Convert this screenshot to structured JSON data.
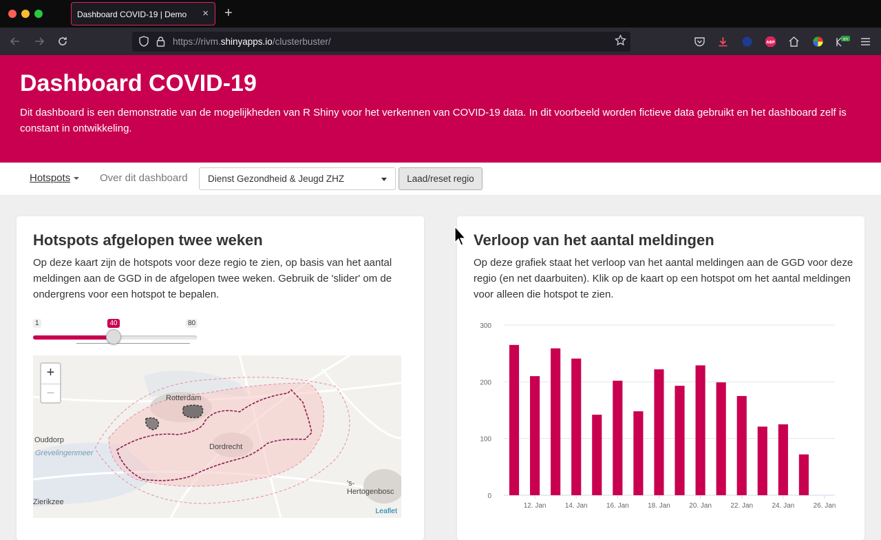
{
  "browser": {
    "tab_title": "Dashboard COVID-19 | Demo",
    "url_prefix": "https://rivm.",
    "url_domain": "shinyapps.io",
    "url_path": "/clusterbuster/",
    "new_tab_glyph": "+",
    "close_glyph": "×"
  },
  "header": {
    "title": "Dashboard COVID-19",
    "description": "Dit dashboard is een demonstratie van de mogelijkheden van R Shiny voor het verkennen van COVID-19 data. In dit voorbeeld worden fictieve data gebruikt en het dashboard zelf is constant in ontwikkeling."
  },
  "menu": {
    "hotspots_label": "Hotspots",
    "about_label": "Over dit dashboard",
    "region_selected": "Dienst Gezondheid & Jeugd ZHZ",
    "reset_button": "Laad/reset regio"
  },
  "hotspot_card": {
    "title": "Hotspots afgelopen twee weken",
    "description": "Op deze kaart zijn de hotspots voor deze regio te zien, op basis van het aantal meldingen aan de GGD in de afgelopen twee weken. Gebruik de 'slider' om de ondergrens voor een hotspot te bepalen.",
    "slider": {
      "min": "1",
      "max": "80",
      "value": "40",
      "min_num": 1,
      "max_num": 80,
      "value_num": 40
    },
    "map": {
      "zoom_in": "+",
      "zoom_out": "−",
      "labels": [
        "Rotterdam",
        "Ouddorp",
        "Grevelingenmeer",
        "Dordrecht",
        "'s-Hertogenbosc",
        "Zierikzee"
      ],
      "attribution": "Leaflet"
    }
  },
  "chart_card": {
    "title": "Verloop van het aantal meldingen",
    "description": "Op deze grafiek staat het verloop van het aantal meldingen aan de GGD voor deze regio (en net daarbuiten). Klik op de kaart op een hotspot om het aantal meldingen voor alleen die hotspot te zien."
  },
  "colors": {
    "brand": "#c8004f",
    "map_outline": "#8b1a4a"
  },
  "chart_data": {
    "type": "bar",
    "x": [
      "11. Jan",
      "12. Jan",
      "13. Jan",
      "14. Jan",
      "15. Jan",
      "16. Jan",
      "17. Jan",
      "18. Jan",
      "19. Jan",
      "20. Jan",
      "21. Jan",
      "22. Jan",
      "23. Jan",
      "24. Jan",
      "25. Jan",
      "26. Jan"
    ],
    "values": [
      265,
      210,
      259,
      241,
      142,
      202,
      148,
      222,
      193,
      229,
      199,
      175,
      121,
      125,
      72,
      null
    ],
    "tick_labels": [
      "12. Jan",
      "14. Jan",
      "16. Jan",
      "18. Jan",
      "20. Jan",
      "22. Jan",
      "24. Jan",
      "26. Jan"
    ],
    "yticks": [
      "0",
      "100",
      "200",
      "300"
    ],
    "ylim": [
      0,
      300
    ],
    "color": "#c8004f",
    "grid": true,
    "legend": "none"
  }
}
